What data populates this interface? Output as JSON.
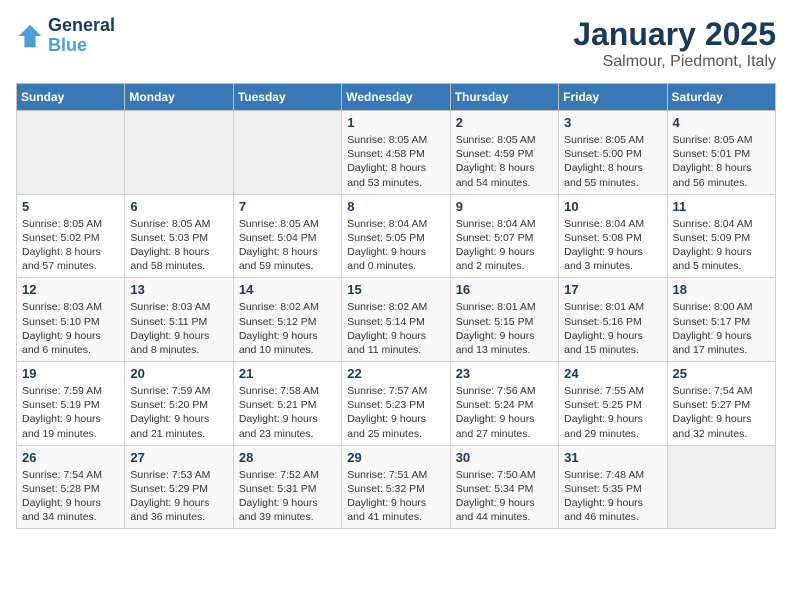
{
  "header": {
    "logo_line1": "General",
    "logo_line2": "Blue",
    "main_title": "January 2025",
    "subtitle": "Salmour, Piedmont, Italy"
  },
  "days_of_week": [
    "Sunday",
    "Monday",
    "Tuesday",
    "Wednesday",
    "Thursday",
    "Friday",
    "Saturday"
  ],
  "weeks": [
    [
      {
        "day": "",
        "content": ""
      },
      {
        "day": "",
        "content": ""
      },
      {
        "day": "",
        "content": ""
      },
      {
        "day": "1",
        "content": "Sunrise: 8:05 AM\nSunset: 4:58 PM\nDaylight: 8 hours and 53 minutes."
      },
      {
        "day": "2",
        "content": "Sunrise: 8:05 AM\nSunset: 4:59 PM\nDaylight: 8 hours and 54 minutes."
      },
      {
        "day": "3",
        "content": "Sunrise: 8:05 AM\nSunset: 5:00 PM\nDaylight: 8 hours and 55 minutes."
      },
      {
        "day": "4",
        "content": "Sunrise: 8:05 AM\nSunset: 5:01 PM\nDaylight: 8 hours and 56 minutes."
      }
    ],
    [
      {
        "day": "5",
        "content": "Sunrise: 8:05 AM\nSunset: 5:02 PM\nDaylight: 8 hours and 57 minutes."
      },
      {
        "day": "6",
        "content": "Sunrise: 8:05 AM\nSunset: 5:03 PM\nDaylight: 8 hours and 58 minutes."
      },
      {
        "day": "7",
        "content": "Sunrise: 8:05 AM\nSunset: 5:04 PM\nDaylight: 8 hours and 59 minutes."
      },
      {
        "day": "8",
        "content": "Sunrise: 8:04 AM\nSunset: 5:05 PM\nDaylight: 9 hours and 0 minutes."
      },
      {
        "day": "9",
        "content": "Sunrise: 8:04 AM\nSunset: 5:07 PM\nDaylight: 9 hours and 2 minutes."
      },
      {
        "day": "10",
        "content": "Sunrise: 8:04 AM\nSunset: 5:08 PM\nDaylight: 9 hours and 3 minutes."
      },
      {
        "day": "11",
        "content": "Sunrise: 8:04 AM\nSunset: 5:09 PM\nDaylight: 9 hours and 5 minutes."
      }
    ],
    [
      {
        "day": "12",
        "content": "Sunrise: 8:03 AM\nSunset: 5:10 PM\nDaylight: 9 hours and 6 minutes."
      },
      {
        "day": "13",
        "content": "Sunrise: 8:03 AM\nSunset: 5:11 PM\nDaylight: 9 hours and 8 minutes."
      },
      {
        "day": "14",
        "content": "Sunrise: 8:02 AM\nSunset: 5:12 PM\nDaylight: 9 hours and 10 minutes."
      },
      {
        "day": "15",
        "content": "Sunrise: 8:02 AM\nSunset: 5:14 PM\nDaylight: 9 hours and 11 minutes."
      },
      {
        "day": "16",
        "content": "Sunrise: 8:01 AM\nSunset: 5:15 PM\nDaylight: 9 hours and 13 minutes."
      },
      {
        "day": "17",
        "content": "Sunrise: 8:01 AM\nSunset: 5:16 PM\nDaylight: 9 hours and 15 minutes."
      },
      {
        "day": "18",
        "content": "Sunrise: 8:00 AM\nSunset: 5:17 PM\nDaylight: 9 hours and 17 minutes."
      }
    ],
    [
      {
        "day": "19",
        "content": "Sunrise: 7:59 AM\nSunset: 5:19 PM\nDaylight: 9 hours and 19 minutes."
      },
      {
        "day": "20",
        "content": "Sunrise: 7:59 AM\nSunset: 5:20 PM\nDaylight: 9 hours and 21 minutes."
      },
      {
        "day": "21",
        "content": "Sunrise: 7:58 AM\nSunset: 5:21 PM\nDaylight: 9 hours and 23 minutes."
      },
      {
        "day": "22",
        "content": "Sunrise: 7:57 AM\nSunset: 5:23 PM\nDaylight: 9 hours and 25 minutes."
      },
      {
        "day": "23",
        "content": "Sunrise: 7:56 AM\nSunset: 5:24 PM\nDaylight: 9 hours and 27 minutes."
      },
      {
        "day": "24",
        "content": "Sunrise: 7:55 AM\nSunset: 5:25 PM\nDaylight: 9 hours and 29 minutes."
      },
      {
        "day": "25",
        "content": "Sunrise: 7:54 AM\nSunset: 5:27 PM\nDaylight: 9 hours and 32 minutes."
      }
    ],
    [
      {
        "day": "26",
        "content": "Sunrise: 7:54 AM\nSunset: 5:28 PM\nDaylight: 9 hours and 34 minutes."
      },
      {
        "day": "27",
        "content": "Sunrise: 7:53 AM\nSunset: 5:29 PM\nDaylight: 9 hours and 36 minutes."
      },
      {
        "day": "28",
        "content": "Sunrise: 7:52 AM\nSunset: 5:31 PM\nDaylight: 9 hours and 39 minutes."
      },
      {
        "day": "29",
        "content": "Sunrise: 7:51 AM\nSunset: 5:32 PM\nDaylight: 9 hours and 41 minutes."
      },
      {
        "day": "30",
        "content": "Sunrise: 7:50 AM\nSunset: 5:34 PM\nDaylight: 9 hours and 44 minutes."
      },
      {
        "day": "31",
        "content": "Sunrise: 7:48 AM\nSunset: 5:35 PM\nDaylight: 9 hours and 46 minutes."
      },
      {
        "day": "",
        "content": ""
      }
    ]
  ]
}
